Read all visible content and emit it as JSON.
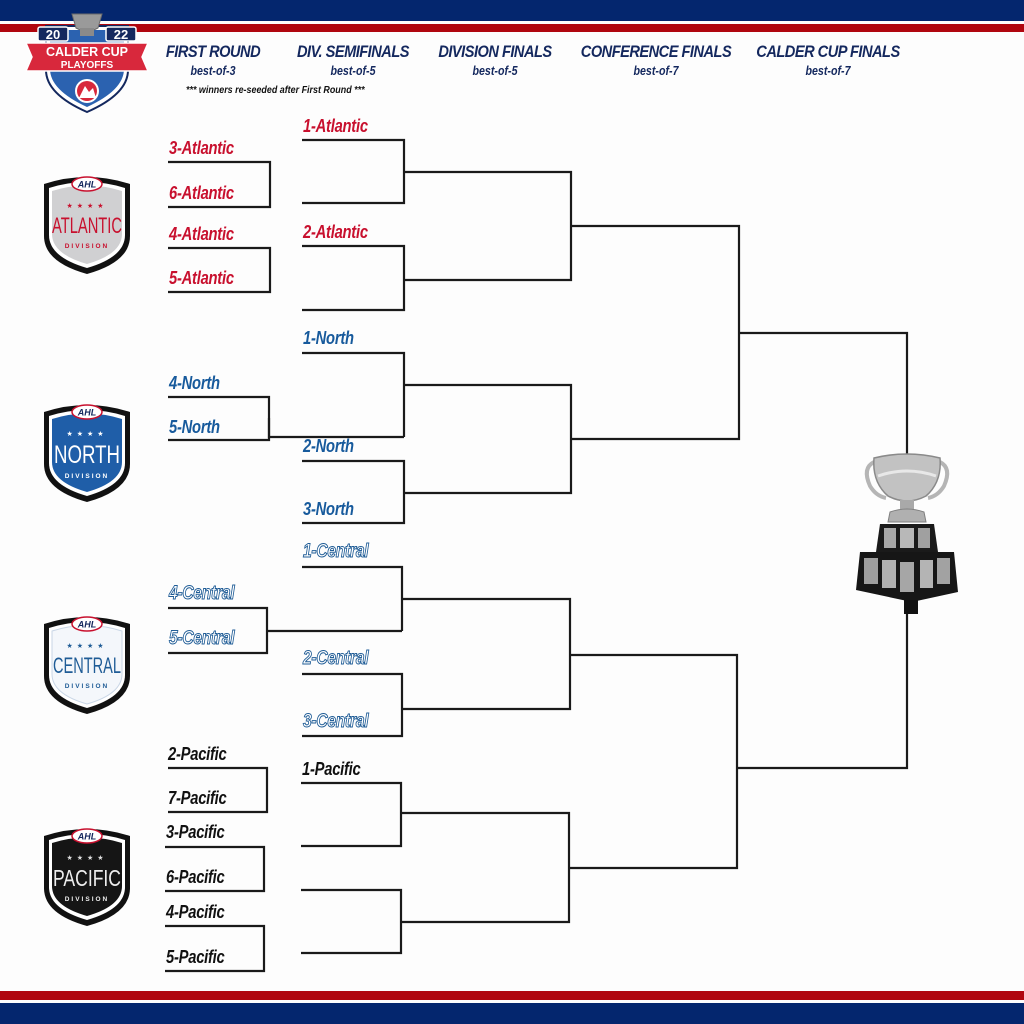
{
  "colors": {
    "navy": "#04266e",
    "red": "#b0060f",
    "atlantic": "#c8102e",
    "north": "#175a9c",
    "central": "#1f5c96",
    "pacific": "#111111",
    "line": "#1a1a1a"
  },
  "logo": {
    "year_left": "20",
    "year_right": "22",
    "line1": "CALDER CUP",
    "line2": "PLAYOFFS"
  },
  "rounds": [
    {
      "title": "FIRST ROUND",
      "format": "best-of-3"
    },
    {
      "title": "DIV. SEMIFINALS",
      "format": "best-of-5"
    },
    {
      "title": "DIVISION FINALS",
      "format": "best-of-5"
    },
    {
      "title": "CONFERENCE FINALS",
      "format": "best-of-7"
    },
    {
      "title": "CALDER CUP FINALS",
      "format": "best-of-7"
    }
  ],
  "note": "*** winners re-seeded after First Round ***",
  "divisions": [
    {
      "name": "ATLANTIC",
      "sub": "DIVISION",
      "badge_league": "AHL",
      "first_round": [
        "3-Atlantic",
        "6-Atlantic",
        "4-Atlantic",
        "5-Atlantic"
      ],
      "semis": [
        "1-Atlantic",
        "2-Atlantic"
      ]
    },
    {
      "name": "NORTH",
      "sub": "DIVISION",
      "badge_league": "AHL",
      "first_round": [
        "4-North",
        "5-North"
      ],
      "semis": [
        "1-North",
        "2-North",
        "3-North"
      ]
    },
    {
      "name": "CENTRAL",
      "sub": "DIVISION",
      "badge_league": "AHL",
      "first_round": [
        "4-Central",
        "5-Central"
      ],
      "semis": [
        "1-Central",
        "2-Central",
        "3-Central"
      ]
    },
    {
      "name": "PACIFIC",
      "sub": "DIVISION",
      "badge_league": "AHL",
      "first_round": [
        "2-Pacific",
        "7-Pacific",
        "3-Pacific",
        "6-Pacific",
        "4-Pacific",
        "5-Pacific"
      ],
      "semis": [
        "1-Pacific"
      ]
    }
  ],
  "trophy": "calder-cup-trophy"
}
